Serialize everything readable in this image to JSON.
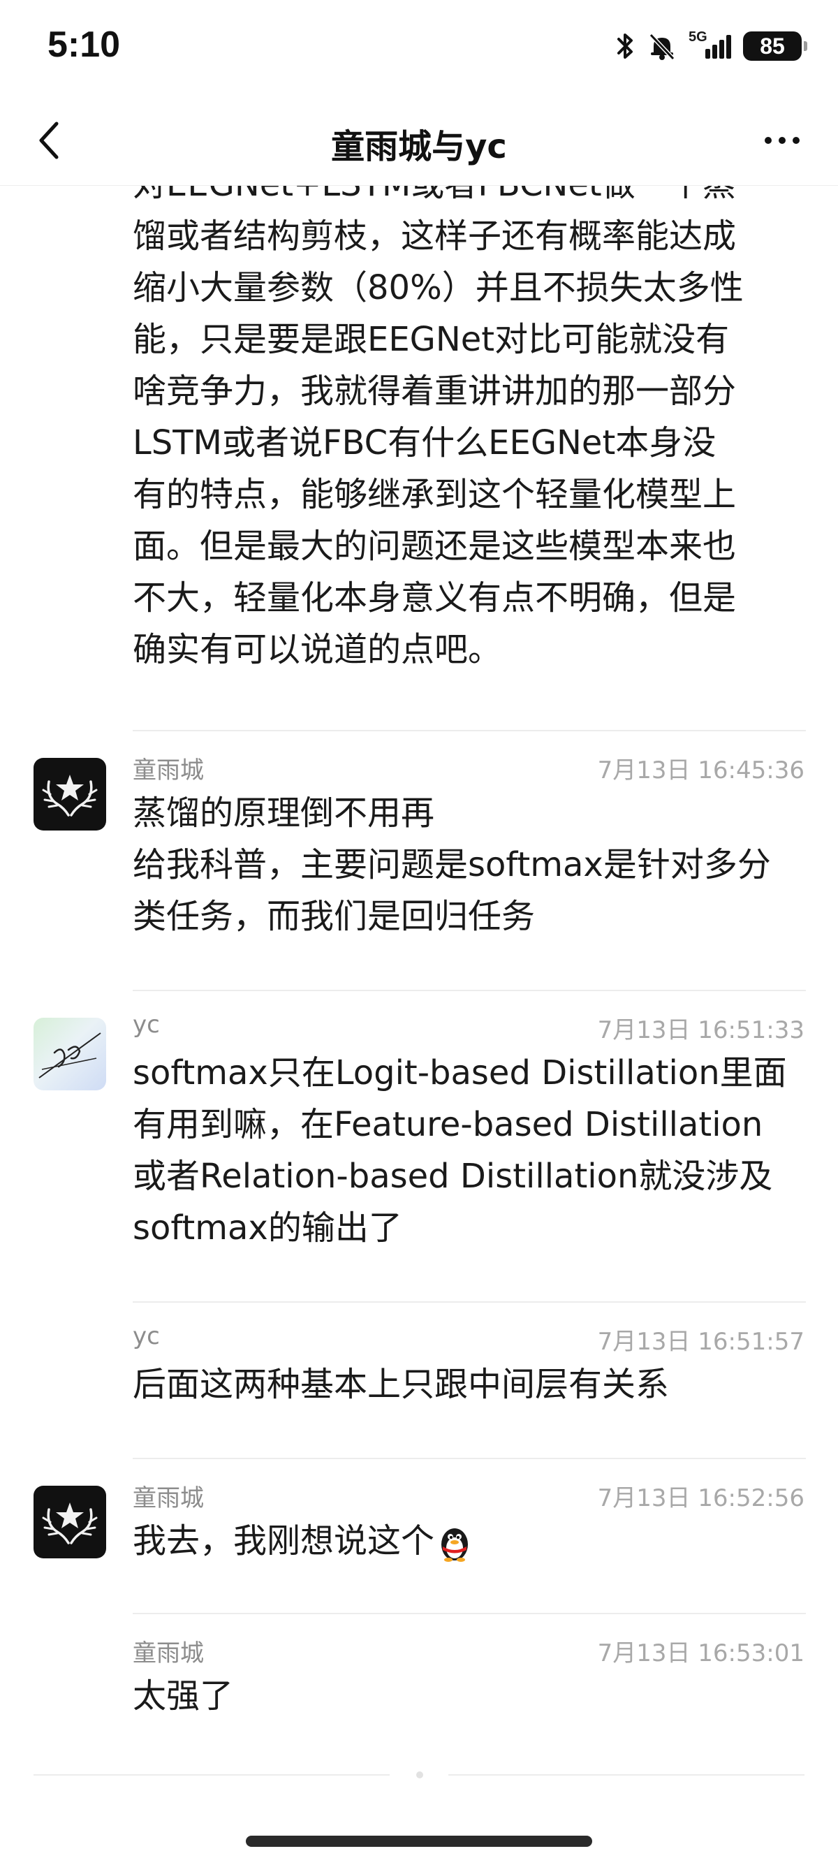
{
  "status_bar": {
    "time": "5:10",
    "battery": "85",
    "network": "5G",
    "icons": [
      "bluetooth-icon",
      "mute-bell-icon",
      "signal-icon",
      "battery-icon"
    ]
  },
  "nav": {
    "title": "童雨城与yc",
    "back_icon": "chevron-left-icon",
    "more_icon": "more-dots-icon"
  },
  "messages": [
    {
      "text_lines": [
        "对EEGNet+LSTM或者FBCNet做一个蒸",
        "馏或者结构剪枝，这样子还有概率能达成",
        "缩小大量参数（80%）并且不损失太多性",
        "能，只是要是跟EEGNet对比可能就没有",
        "啥竞争力，我就得着重讲讲加的那一部分",
        "LSTM或者说FBC有什么EEGNet本身没",
        "有的特点，能够继承到这个轻量化模型上",
        "面。但是最大的问题还是这些模型本来也",
        "不大，轻量化本身意义有点不明确，但是",
        "确实有可以说道的点吧。"
      ]
    },
    {
      "sender": "童雨城",
      "time": "7月13日 16:45:36",
      "text_lines": [
        "蒸馏的原理倒不用再",
        "给我科普，主要问题是softmax是针对多分",
        "类任务，而我们是回归任务"
      ]
    },
    {
      "sender": "yc",
      "time": "7月13日 16:51:33",
      "text_lines": [
        "softmax只在Logit-based Distillation里面",
        "有用到嘛，在Feature-based Distillation",
        "或者Relation-based Distillation就没涉及",
        "softmax的输出了"
      ]
    },
    {
      "sender": "yc",
      "time": "7月13日 16:51:57",
      "text_lines": [
        "后面这两种基本上只跟中间层有关系"
      ]
    },
    {
      "sender": "童雨城",
      "time": "7月13日 16:52:56",
      "text_lines": [
        "我去，我刚想说这个"
      ],
      "emoji": "penguin-emoji-icon"
    },
    {
      "sender": "童雨城",
      "time": "7月13日 16:53:01",
      "text_lines": [
        "太强了"
      ]
    }
  ]
}
